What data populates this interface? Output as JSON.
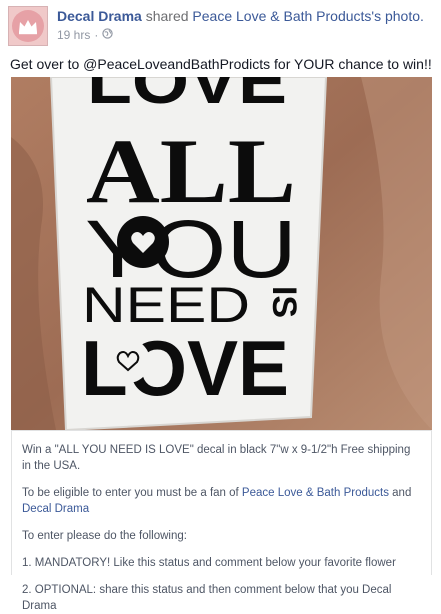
{
  "post": {
    "author": "Decal Drama",
    "action": "shared",
    "target": "Peace Love & Bath Products",
    "target_suffix": "'s photo.",
    "time": "19 hrs",
    "separator": "·",
    "privacy_icon": "globe-icon",
    "message": "Get over to @PeaceLoveandBathProdicts for YOUR chance to win!!"
  },
  "photo": {
    "lines": [
      "LOVE",
      "ALL",
      "YOU",
      "NEED",
      "IS",
      "LOVE"
    ]
  },
  "caption": {
    "p1": "Win a \"ALL YOU NEED IS LOVE\" decal in black 7\"w x 9-1/2\"h Free shipping in the USA.",
    "p2_before": "To be eligible to enter you must be a fan of ",
    "p2_link1": "Peace Love & Bath Products",
    "p2_mid": " and ",
    "p2_link2": "Decal Drama",
    "p3": "To enter please do the following:",
    "p4": "1. MANDATORY! Like this status and comment below your favorite flower",
    "p5": "2. OPTIONAL: share this status and then comment below that you Decal Drama"
  },
  "colors": {
    "link": "#3b5998",
    "text": "#141823",
    "muted": "#9197a3",
    "decal": "#0c0c0c",
    "fabric": "#a8745a"
  }
}
